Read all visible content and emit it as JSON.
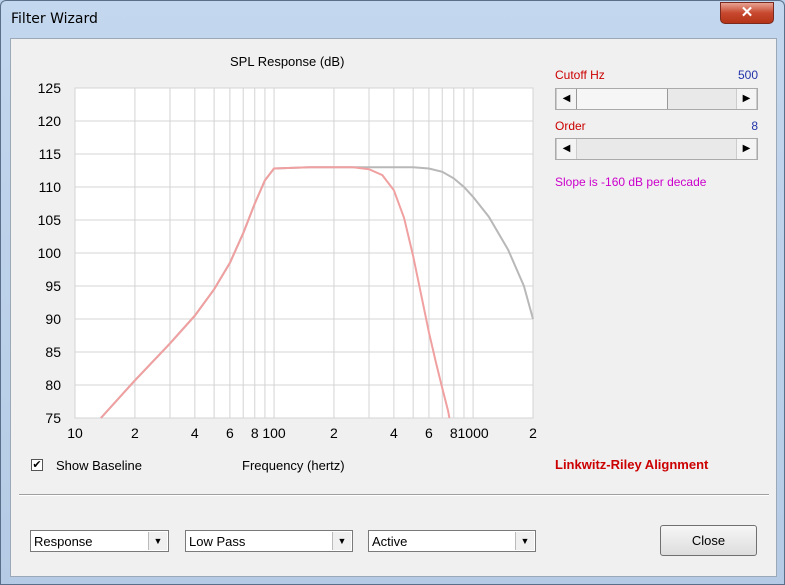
{
  "window": {
    "title": "Filter Wizard",
    "close_glyph": "✕"
  },
  "chart_data": {
    "type": "line",
    "title": "SPL Response (dB)",
    "xlabel": "Frequency (hertz)",
    "ylabel": "",
    "xscale": "log",
    "xlim": [
      10,
      2000
    ],
    "ylim": [
      75,
      125
    ],
    "y_ticks": [
      "125",
      "120",
      "115",
      "110",
      "105",
      "100",
      "95",
      "90",
      "85",
      "80",
      "75"
    ],
    "x_ticks": [
      "10",
      "2",
      "4",
      "6",
      "8",
      "100",
      "2",
      "4",
      "6",
      "8",
      "1000",
      "2"
    ],
    "grid": true,
    "series": [
      {
        "role": "baseline",
        "color": "#b8b8b8",
        "x": [
          13.5,
          20,
          30,
          40,
          50,
          60,
          70,
          80,
          90,
          100,
          150,
          200,
          300,
          400,
          500,
          600,
          700,
          800,
          900,
          1000,
          1200,
          1500,
          1800,
          2000
        ],
        "y": [
          75,
          80.7,
          86.3,
          90.5,
          94.5,
          98.5,
          103,
          107.5,
          111,
          112.8,
          113,
          113,
          113,
          113,
          113,
          112.8,
          112.3,
          111.3,
          110,
          108.5,
          105.5,
          100.5,
          95,
          90
        ]
      },
      {
        "role": "filtered",
        "color": "#f0a0a0",
        "x": [
          13.5,
          20,
          30,
          40,
          50,
          60,
          70,
          80,
          90,
          100,
          150,
          200,
          250,
          300,
          350,
          400,
          450,
          500,
          550,
          600,
          650,
          700,
          750,
          760
        ],
        "y": [
          75,
          80.7,
          86.3,
          90.5,
          94.5,
          98.5,
          103,
          107.5,
          111,
          112.8,
          113,
          113,
          113,
          112.7,
          111.8,
          109.5,
          105.3,
          99.5,
          93.5,
          88,
          83.5,
          79.5,
          76,
          75
        ]
      }
    ]
  },
  "controls": {
    "cutoff_label": "Cutoff  Hz",
    "cutoff_value": "500",
    "cutoff_fraction": 0.55,
    "order_label": "Order",
    "order_value": "8",
    "order_fraction": 1.0,
    "slope_text": "Slope is -160 dB per decade",
    "show_baseline_label": "Show Baseline",
    "show_baseline_checked": "✔",
    "alignment_text": "Linkwitz-Riley Alignment"
  },
  "bottom": {
    "view_select": "Response",
    "type_select": "Low Pass",
    "mode_select": "Active",
    "close_label": "Close"
  },
  "icons": {
    "scroll_left": "◀",
    "scroll_right": "▶",
    "dropdown": "▼"
  }
}
